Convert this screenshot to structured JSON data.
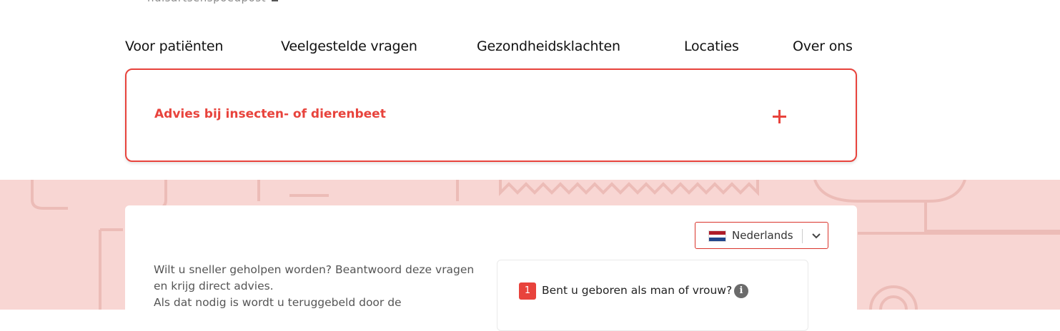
{
  "header": {
    "logo_text": "huisartsenspoedpost"
  },
  "nav": {
    "items": [
      {
        "label": "Voor patiënten"
      },
      {
        "label": "Veelgestelde vragen"
      },
      {
        "label": "Gezondheidsklachten"
      },
      {
        "label": "Locaties"
      },
      {
        "label": "Over ons"
      }
    ]
  },
  "accordion": {
    "title": "Advies bij insecten- of dierenbeet",
    "icon": "plus-icon"
  },
  "language": {
    "selected": "Nederlands",
    "flag": "nl-flag-icon",
    "chevron": "chevron-down-icon"
  },
  "intro": {
    "line1": "Wilt u sneller geholpen worden? Beantwoord deze vragen en krijg direct advies.",
    "line2": "Als dat nodig is wordt u teruggebeld door de"
  },
  "question": {
    "number": "1",
    "text": "Bent u geboren als man of vrouw?",
    "info_icon": "i"
  },
  "colors": {
    "accent": "#e8433c",
    "band": "#f8d6d3"
  }
}
